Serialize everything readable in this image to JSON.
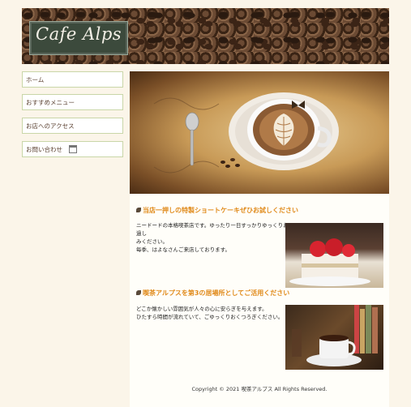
{
  "header": {
    "logo_text": "Cafe Alps"
  },
  "sidebar": {
    "items": [
      {
        "label": "ホーム"
      },
      {
        "label": "おすすめメニュー"
      },
      {
        "label": "お店へのアクセス"
      },
      {
        "label": "お問い合わせ"
      }
    ]
  },
  "main": {
    "section1": {
      "title": "当店一押しの特製ショートケーキぜひお試しください",
      "text": [
        "ニードードの本格喫茶店です。ゆったり一日すっかりゆっくりお過し",
        "みください。",
        "每季、はよなさんご来店しております。"
      ]
    },
    "section2": {
      "title": "喫茶アルプスを第3の居場所としてご活用ください",
      "text": [
        "どこか懐かしい雰囲気が人々の心に安らぎを与えます。",
        "ひたすら時間が流れていて、ごゆっくりおくつろぎください。"
      ]
    },
    "footer": "Copyright © 2021 喫茶アルプス All Rights Reserved."
  },
  "colors": {
    "accent": "#e08a1a",
    "nav_border": "#c9d6a8",
    "logo_bg": "#3c4a3c",
    "page_bg": "#fbf5e9"
  }
}
